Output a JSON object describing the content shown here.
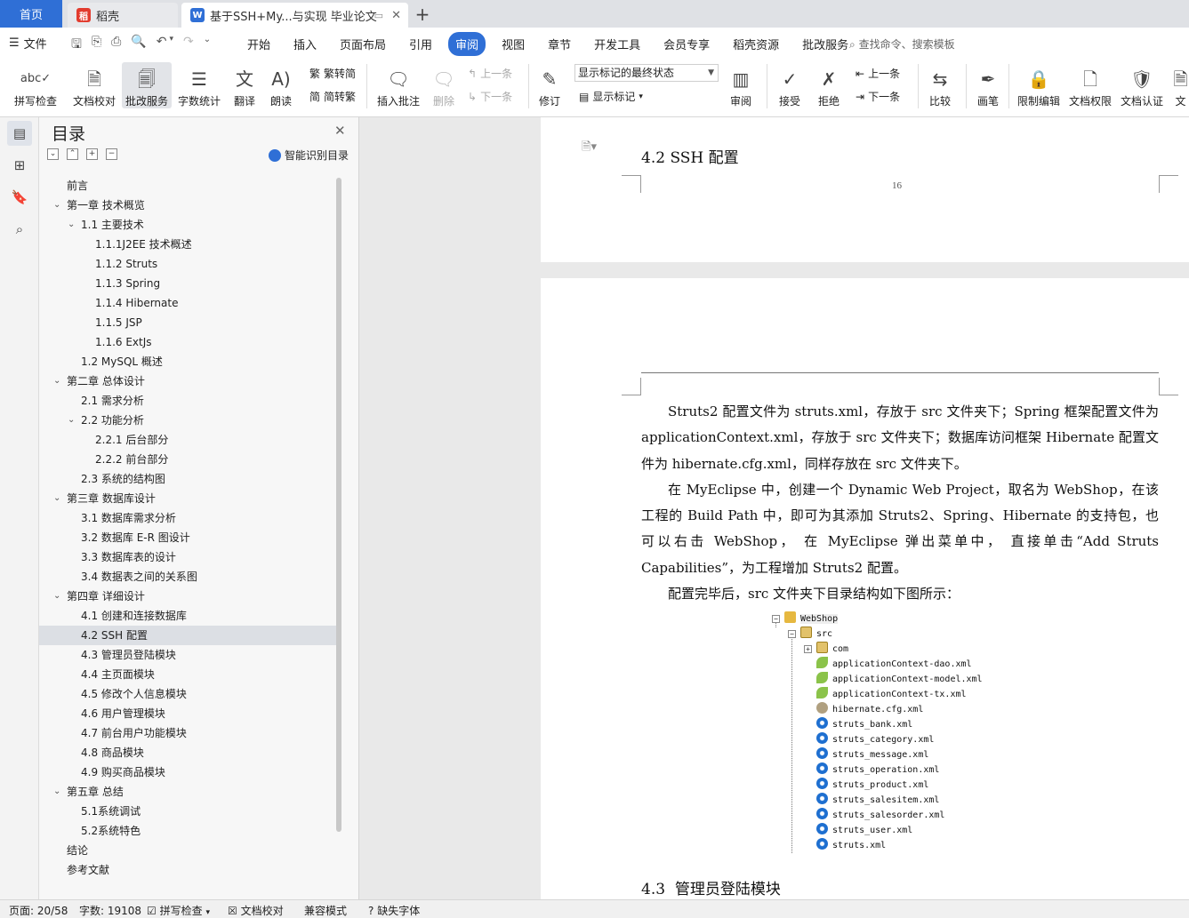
{
  "tabs": {
    "home": "首页",
    "app": "稻壳",
    "document": "基于SSH+My...与实现 毕业论文"
  },
  "menu": {
    "file": "文件",
    "items": [
      "开始",
      "插入",
      "页面布局",
      "引用",
      "审阅",
      "视图",
      "章节",
      "开发工具",
      "会员专享",
      "稻壳资源",
      "批改服务"
    ],
    "active": "审阅",
    "search": "查找命令、搜索模板"
  },
  "ribbon": {
    "spellcheck": "拼写检查",
    "doc_proof": "文档校对",
    "review_service": "批改服务",
    "word_count": "字数统计",
    "translate": "翻译",
    "read_aloud": "朗读",
    "to_traditional": "繁转简",
    "to_simplified": "简转繁",
    "insert_comment": "插入批注",
    "delete": "删除",
    "prev_comment": "上一条",
    "next_comment": "下一条",
    "track_changes": "修订",
    "markup_state": "显示标记的最终状态",
    "show_markup": "显示标记",
    "review": "审阅",
    "accept": "接受",
    "reject": "拒绝",
    "prev_change": "上一条",
    "next_change": "下一条",
    "compare": "比较",
    "ink": "画笔",
    "restrict_edit": "限制编辑",
    "doc_permission": "文档权限",
    "doc_cert": "文档认证",
    "more": "文"
  },
  "toc": {
    "title": "目录",
    "smart_label": "智能识别目录",
    "items": [
      {
        "label": "前言",
        "level": 1,
        "arrow": false
      },
      {
        "label": "第一章  技术概览",
        "level": 1,
        "arrow": true
      },
      {
        "label": "1.1  主要技术",
        "level": 2,
        "arrow": true
      },
      {
        "label": "1.1.1J2EE 技术概述",
        "level": 3,
        "arrow": false
      },
      {
        "label": "1.1.2 Struts",
        "level": 3,
        "arrow": false
      },
      {
        "label": "1.1.3 Spring",
        "level": 3,
        "arrow": false
      },
      {
        "label": "1.1.4 Hibernate",
        "level": 3,
        "arrow": false
      },
      {
        "label": "1.1.5 JSP",
        "level": 3,
        "arrow": false
      },
      {
        "label": "1.1.6 ExtJs",
        "level": 3,
        "arrow": false
      },
      {
        "label": "1.2 MySQL 概述",
        "level": 2,
        "arrow": false
      },
      {
        "label": "第二章  总体设计",
        "level": 1,
        "arrow": true
      },
      {
        "label": "2.1  需求分析",
        "level": 2,
        "arrow": false
      },
      {
        "label": "2.2  功能分析",
        "level": 2,
        "arrow": true
      },
      {
        "label": "2.2.1  后台部分",
        "level": 3,
        "arrow": false
      },
      {
        "label": "2.2.2  前台部分",
        "level": 3,
        "arrow": false
      },
      {
        "label": "2.3  系统的结构图",
        "level": 2,
        "arrow": false
      },
      {
        "label": "第三章  数据库设计",
        "level": 1,
        "arrow": true
      },
      {
        "label": "3.1  数据库需求分析",
        "level": 2,
        "arrow": false
      },
      {
        "label": "3.2  数据库 E-R 图设计",
        "level": 2,
        "arrow": false
      },
      {
        "label": "3.3  数据库表的设计",
        "level": 2,
        "arrow": false
      },
      {
        "label": "3.4  数据表之间的关系图",
        "level": 2,
        "arrow": false
      },
      {
        "label": "第四章  详细设计",
        "level": 1,
        "arrow": true
      },
      {
        "label": "4.1  创建和连接数据库",
        "level": 2,
        "arrow": false
      },
      {
        "label": "4.2 SSH 配置",
        "level": 2,
        "arrow": false,
        "selected": true
      },
      {
        "label": "4.3  管理员登陆模块",
        "level": 2,
        "arrow": false
      },
      {
        "label": "4.4 主页面模块",
        "level": 2,
        "arrow": false
      },
      {
        "label": "4.5  修改个人信息模块",
        "level": 2,
        "arrow": false
      },
      {
        "label": "4.6  用户管理模块",
        "level": 2,
        "arrow": false
      },
      {
        "label": "4.7  前台用户功能模块",
        "level": 2,
        "arrow": false
      },
      {
        "label": "4.8  商品模块",
        "level": 2,
        "arrow": false
      },
      {
        "label": "4.9  购买商品模块",
        "level": 2,
        "arrow": false
      },
      {
        "label": "第五章  总结",
        "level": 1,
        "arrow": true
      },
      {
        "label": "5.1系统调试",
        "level": 2,
        "arrow": false
      },
      {
        "label": "5.2系统特色",
        "level": 2,
        "arrow": false
      },
      {
        "label": "结论",
        "level": 1,
        "arrow": false
      },
      {
        "label": "参考文献",
        "level": 1,
        "arrow": false
      }
    ]
  },
  "doc": {
    "section_heading": "4.2 SSH 配置",
    "page_number": "16",
    "paragraphs": [
      "Struts2 配置文件为 struts.xml，存放于 src 文件夹下；Spring 框架配置文件为 applicationContext.xml，存放于 src 文件夹下；数据库访问框架 Hibernate 配置文件为 hibernate.cfg.xml，同样存放在 src 文件夹下。",
      "在 MyEclipse 中，创建一个 Dynamic Web Project，取名为 WebShop，在该工程的 Build Path 中，即可为其添加 Struts2、Spring、Hibernate 的支持包，也可以右击 WebShop， 在 MyEclipse 弹出菜单中， 直接单击“Add Struts Capabilities”，为工程增加 Struts2 配置。",
      "配置完毕后，src 文件夹下目录结构如下图所示："
    ],
    "tree": {
      "project": "WebShop",
      "src": "src",
      "package": "com",
      "files": [
        {
          "name": "applicationContext-dao.xml",
          "icon": "spring-leaf-icon"
        },
        {
          "name": "applicationContext-model.xml",
          "icon": "spring-leaf-icon"
        },
        {
          "name": "applicationContext-tx.xml",
          "icon": "spring-leaf-icon"
        },
        {
          "name": "hibernate.cfg.xml",
          "icon": "hibernate-icon"
        },
        {
          "name": "struts_bank.xml",
          "icon": "struts-gear-icon"
        },
        {
          "name": "struts_category.xml",
          "icon": "struts-gear-icon"
        },
        {
          "name": "struts_message.xml",
          "icon": "struts-gear-icon"
        },
        {
          "name": "struts_operation.xml",
          "icon": "struts-gear-icon"
        },
        {
          "name": "struts_product.xml",
          "icon": "struts-gear-icon"
        },
        {
          "name": "struts_salesitem.xml",
          "icon": "struts-gear-icon"
        },
        {
          "name": "struts_salesorder.xml",
          "icon": "struts-gear-icon"
        },
        {
          "name": "struts_user.xml",
          "icon": "struts-gear-icon"
        },
        {
          "name": "struts.xml",
          "icon": "struts-gear-icon"
        }
      ]
    },
    "next_heading_num": "4.3",
    "next_heading_text": "管理员登陆模块"
  },
  "status": {
    "page": "页面: 20/58",
    "words": "字数: 19108",
    "spellcheck": "拼写检查",
    "proof": "文档校对",
    "compat": "兼容模式",
    "missing_font": "缺失字体"
  }
}
